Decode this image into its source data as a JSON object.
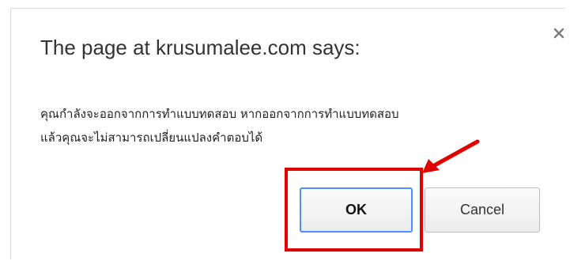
{
  "dialog": {
    "title": "The page at krusumalee.com says:",
    "message_lines": [
      "คุณกำลังจะออกจากการทำแบบทดสอบ หากออกจากการทำแบบทดสอบ",
      "แล้วคุณจะไม่สามารถเปลี่ยนแปลงคำตอบได้"
    ],
    "ok_label": "OK",
    "cancel_label": "Cancel",
    "close_icon": "close-icon"
  },
  "annotation": {
    "highlight_color": "#e00000",
    "focus_color": "#4d90fe"
  }
}
